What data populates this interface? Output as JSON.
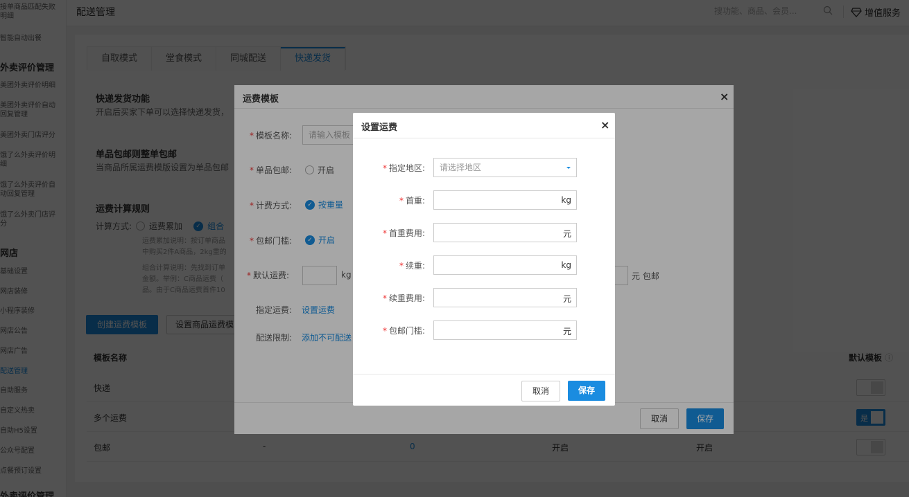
{
  "sidebar": {
    "items": [
      {
        "label": "接单商品匹配失败明细"
      },
      {
        "label": "智能自动出餐"
      },
      {
        "label": "外卖评价管理",
        "heading": true
      },
      {
        "label": "美团外卖评价明细"
      },
      {
        "label": "美团外卖评价自动回复管理"
      },
      {
        "label": "美团外卖门店评分"
      },
      {
        "label": "饿了么外卖评价明细"
      },
      {
        "label": "饿了么外卖评价自动回复管理"
      },
      {
        "label": "饿了么外卖门店评分"
      },
      {
        "label": "网店",
        "heading": true
      },
      {
        "label": "基础设置"
      },
      {
        "label": "网店装修"
      },
      {
        "label": "小程序装修"
      },
      {
        "label": "网店公告"
      },
      {
        "label": "网店广告"
      },
      {
        "label": "配送管理",
        "active": true
      },
      {
        "label": "自助服务"
      },
      {
        "label": "自定义热卖"
      },
      {
        "label": "自助H5设置"
      },
      {
        "label": "公众号配置"
      },
      {
        "label": "点餐预订设置"
      },
      {
        "label": "外卖评价管理",
        "heading": true
      }
    ]
  },
  "header": {
    "title": "配送管理",
    "search_placeholder": "搜功能、商品、会员...",
    "search_icon": "search-icon",
    "vas_icon": "diamond-icon",
    "vas_label": "增值服务"
  },
  "tabs": [
    {
      "label": "自取模式"
    },
    {
      "label": "堂食模式"
    },
    {
      "label": "同城配送"
    },
    {
      "label": "快递发货",
      "active": true
    }
  ],
  "main": {
    "express_title": "快递发货功能",
    "express_desc": "开启后买家下单可以选择快递发货，",
    "single_title": "单品包邮则整单包邮",
    "single_desc": "当商品所属运费模版设置为单品包邮",
    "rule_title": "运费计算规则",
    "rule_label": "计算方式:",
    "rule_option1": "运费累加",
    "rule_option2": "组合",
    "note_lines": [
      "运费累加说明：按订单商品",
      "中购买2件A商品，2kg重的",
      "组合计算说明：先找到订单",
      "金额。举例：C商品运费（",
      "品。由于C商品运费首件10"
    ],
    "create_btn": "创建运费模板",
    "set_btn": "设置商品运费模"
  },
  "table": {
    "headers": {
      "name": "模板名称",
      "default": "默认模板"
    },
    "rows": [
      {
        "name": "快递",
        "c2": "",
        "c3": "",
        "c4": "",
        "c5": "",
        "on": false
      },
      {
        "name": "多个运费",
        "c2": "",
        "c3": "",
        "c4": "",
        "c5": "",
        "on": true,
        "on_text": "是"
      },
      {
        "name": "包邮",
        "c2": "-",
        "c3": "0",
        "c4": "开启",
        "c5": "开启",
        "on": false
      }
    ]
  },
  "modal1": {
    "title": "运费模板",
    "name_label": "模板名称:",
    "name_placeholder": "请输入模板",
    "single_label": "单品包邮:",
    "single_value": "开启",
    "billing_label": "计费方式:",
    "billing_value": "按重量",
    "threshold_label": "包邮门槛:",
    "threshold_value": "开启",
    "default_label": "默认运费:",
    "default_unit": "kg",
    "default_suffix": "元 包邮",
    "specified_label": "指定运费:",
    "specified_link": "设置运费",
    "limit_label": "配送限制:",
    "limit_link": "添加不可配送",
    "cancel": "取消",
    "save": "保存"
  },
  "modal2": {
    "title": "设置运费",
    "fields": [
      {
        "label": "指定地区:",
        "placeholder": "请选择地区",
        "type": "select"
      },
      {
        "label": "首重:",
        "unit": "kg"
      },
      {
        "label": "首重费用:",
        "unit": "元"
      },
      {
        "label": "续重:",
        "unit": "kg"
      },
      {
        "label": "续重费用:",
        "unit": "元"
      },
      {
        "label": "包邮门槛:",
        "unit": "元"
      }
    ],
    "cancel": "取消",
    "save": "保存"
  },
  "colors": {
    "accent": "#1a8ce0",
    "required": "#e33333"
  }
}
